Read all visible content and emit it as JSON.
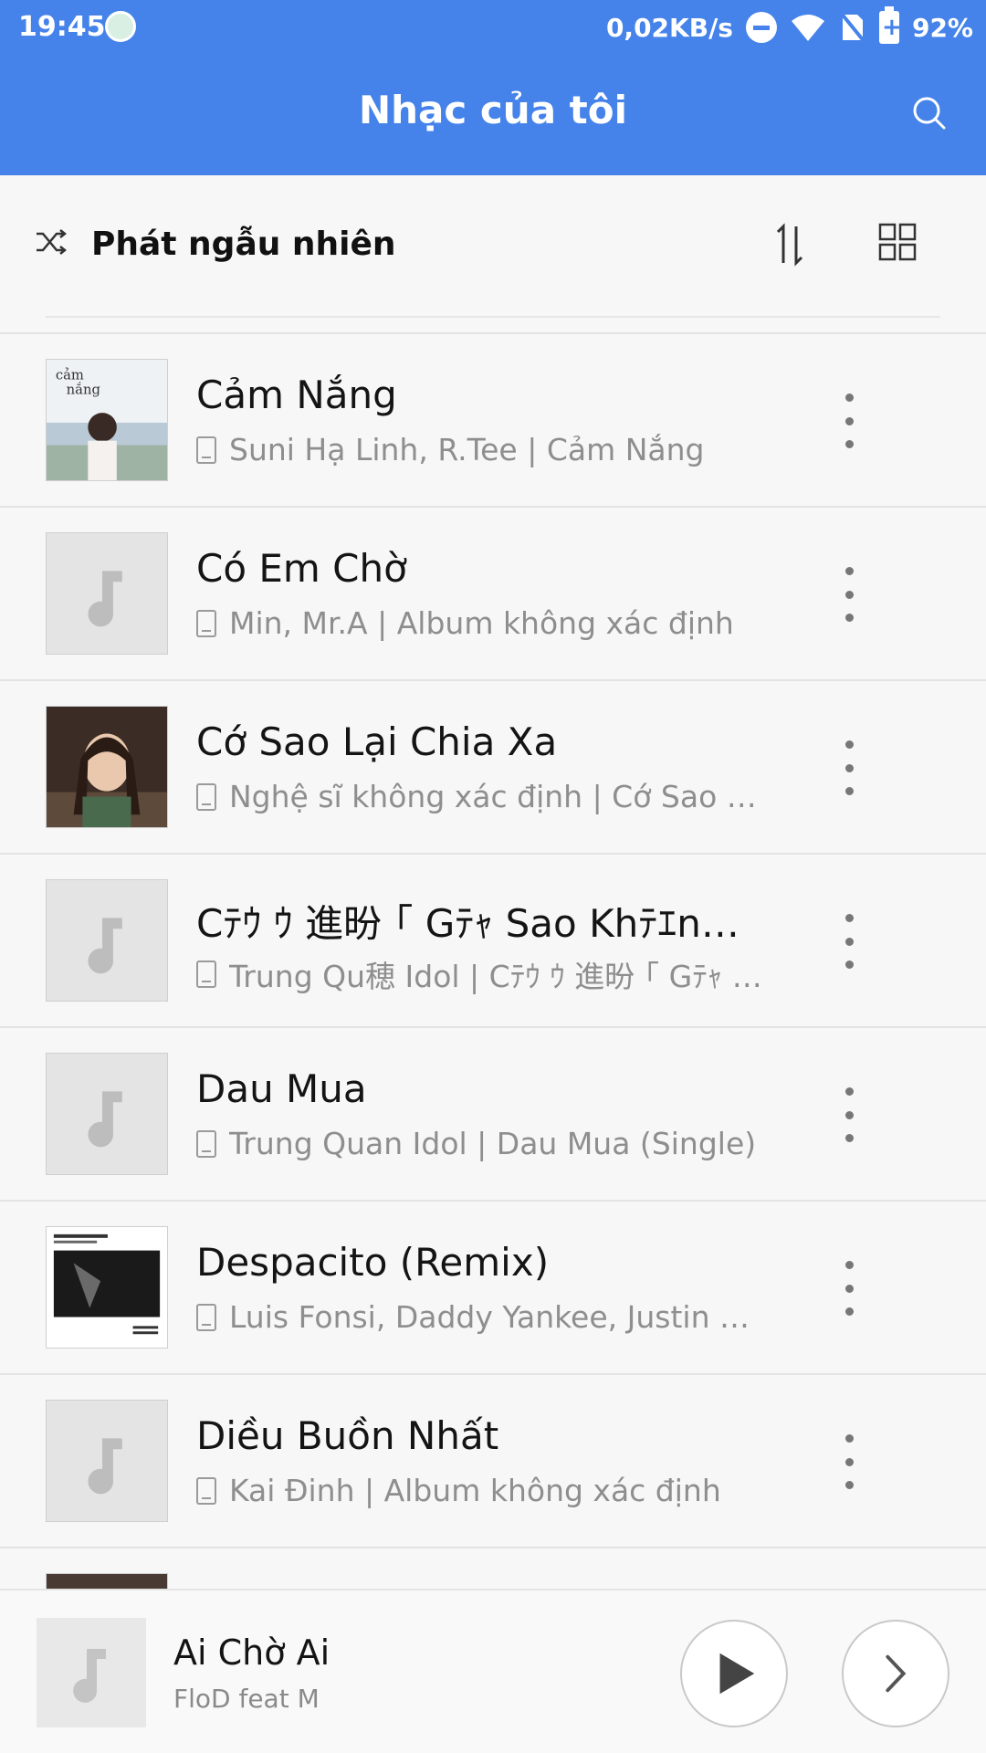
{
  "status_bar": {
    "time": "19:45",
    "network_speed": "0,02KB/s",
    "battery": "92%",
    "icons": [
      "notification-app-icon",
      "do-not-disturb-icon",
      "wifi-icon",
      "no-sim-icon",
      "battery-icon"
    ]
  },
  "header": {
    "title": "Nhạc của tôi",
    "search_icon": "search-icon"
  },
  "toolbar": {
    "shuffle_label": "Phát ngẫu nhiên",
    "sort_icon": "sort-icon",
    "view_icon": "grid-view-icon"
  },
  "songs": [
    {
      "title": "Cảm Nắng",
      "meta": "Suni Hạ Linh, R.Tee | Cảm Nắng",
      "art": "album-art-cam-nang"
    },
    {
      "title": "Có Em Chờ",
      "meta": "Min, Mr.A | Album không xác định",
      "art": "music-note-placeholder"
    },
    {
      "title": "Cớ Sao Lại Chia Xa",
      "meta": "Nghệ sĩ không xác định | Cớ Sao L...",
      "art": "album-art-portrait"
    },
    {
      "title": "Cﾃｳ ｳ 進昐 ｢ Gﾃｬ Sao Khﾃｴng...",
      "meta": "Trung Qu穂 Idol | Cﾃｳ ｳ 進昐 ｢ Gﾃｬ S...",
      "art": "music-note-placeholder"
    },
    {
      "title": "Dau Mua",
      "meta": "Trung Quan Idol | Dau Mua (Single)",
      "art": "music-note-placeholder"
    },
    {
      "title": "Despacito (Remix)",
      "meta": "Luis Fonsi, Daddy Yankee, Justin B...",
      "art": "album-art-despacito"
    },
    {
      "title": "Diều Buồn Nhất",
      "meta": "Kai Đinh | Album không xác định",
      "art": "music-note-placeholder"
    }
  ],
  "now_playing": {
    "title": "Ai Chờ Ai",
    "artist": "FloD feat M"
  },
  "colors": {
    "accent": "#4583ea",
    "background": "#f7f7f7",
    "primary_text": "#141414",
    "secondary_text": "#8e8e8e"
  }
}
